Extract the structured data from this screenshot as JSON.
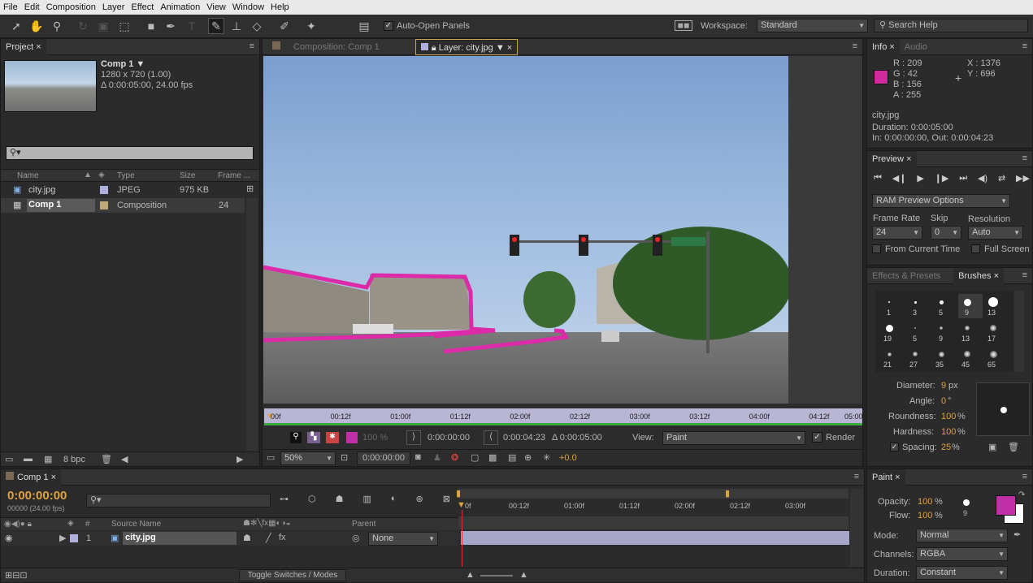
{
  "menu": [
    "File",
    "Edit",
    "Composition",
    "Layer",
    "Effect",
    "Animation",
    "View",
    "Window",
    "Help"
  ],
  "toolbar": {
    "auto_open": "Auto-Open Panels",
    "workspace_label": "Workspace:",
    "workspace_value": "Standard",
    "search_placeholder": "Search Help"
  },
  "project": {
    "tab": "Project",
    "comp_name": "Comp 1 ▼",
    "comp_res": "1280 x 720 (1.00)",
    "comp_dur": "Δ 0:00:05:00, 24.00 fps",
    "search": "⚲▾",
    "cols": {
      "name": "Name",
      "type": "Type",
      "size": "Size",
      "frame": "Frame ..."
    },
    "items": [
      {
        "name": "city.jpg",
        "type": "JPEG",
        "size": "975 KB",
        "frame": ""
      },
      {
        "name": "Comp 1",
        "type": "Composition",
        "size": "",
        "frame": "24"
      }
    ],
    "bpc": "8 bpc"
  },
  "viewer": {
    "tab_comp": "Composition: Comp 1",
    "tab_layer": "Layer: city.jpg",
    "ruler": [
      "00f",
      "00:12f",
      "01:00f",
      "01:12f",
      "02:00f",
      "02:12f",
      "03:00f",
      "03:12f",
      "04:00f",
      "04:12f",
      "05:00"
    ],
    "opacity": "100 %",
    "time_in": "0:00:00:00",
    "time_out": "0:00:04:23",
    "duration": "Δ 0:00:05:00",
    "view_label": "View:",
    "view_value": "Paint",
    "render": "Render",
    "zoom": "50%",
    "current_time": "0:00:00:00",
    "offset": "+0.0"
  },
  "info": {
    "tab": "Info",
    "tab2": "Audio",
    "r": "R : 209",
    "g": "G : 42",
    "b": "B : 156",
    "a": "A : 255",
    "x": "X : 1376",
    "y": "Y : 696",
    "file": "city.jpg",
    "dur": "Duration: 0:00:05:00",
    "inout": "In: 0:00:00:00, Out: 0:00:04:23",
    "swatch": "#d12a9c"
  },
  "preview": {
    "tab": "Preview",
    "ram": "RAM Preview Options",
    "fr_label": "Frame Rate",
    "skip_label": "Skip",
    "res_label": "Resolution",
    "fr": "24",
    "skip": "0",
    "res": "Auto",
    "from_current": "From Current Time",
    "full_screen": "Full Screen"
  },
  "brushes": {
    "tab_fx": "Effects & Presets",
    "tab": "Brushes",
    "sizes": [
      "1",
      "3",
      "5",
      "9",
      "13",
      "19",
      "5",
      "9",
      "13",
      "17",
      "21",
      "27",
      "35",
      "45",
      "65"
    ],
    "diameter_label": "Diameter:",
    "diameter": "9",
    "px": "px",
    "angle_label": "Angle:",
    "angle": "0",
    "deg": "°",
    "round_label": "Roundness:",
    "round": "100",
    "hard_label": "Hardness:",
    "hard": "100",
    "pct": "%",
    "spacing_label": "Spacing:",
    "spacing": "25"
  },
  "timeline": {
    "tab": "Comp 1",
    "time": "0:00:00:00",
    "fps": "00000 (24.00 fps)",
    "search": "⚲▾",
    "col_source": "Source Name",
    "col_parent": "Parent",
    "col_num": "#",
    "ruler": [
      "0f",
      "00:12f",
      "01:00f",
      "01:12f",
      "02:00f",
      "02:12f",
      "03:00f"
    ],
    "layer_num": "1",
    "layer_name": "city.jpg",
    "parent": "None",
    "toggle": "Toggle Switches / Modes"
  },
  "paint": {
    "tab": "Paint",
    "opacity_label": "Opacity:",
    "opacity": "100",
    "flow_label": "Flow:",
    "flow": "100",
    "pct": "%",
    "brush_size": "9",
    "mode_label": "Mode:",
    "mode": "Normal",
    "channels_label": "Channels:",
    "channels": "RGBA",
    "duration_label": "Duration:",
    "duration": "Constant",
    "fg": "#d12a9c",
    "bg": "#ffffff"
  }
}
